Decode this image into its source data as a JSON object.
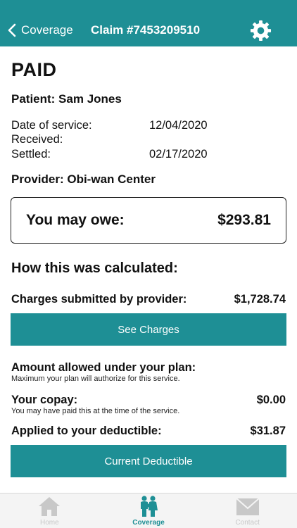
{
  "header": {
    "back_label": "Coverage",
    "title": "Claim #7453209510"
  },
  "claim": {
    "status": "PAID",
    "patient": "Patient: Sam Jones",
    "dates": [
      {
        "label": "Date of service:",
        "value": "12/04/2020"
      },
      {
        "label": "Received:",
        "value": ""
      },
      {
        "label": "Settled:",
        "value": "02/17/2020"
      }
    ],
    "provider": "Provider: Obi-wan Center"
  },
  "owe": {
    "label": "You may owe:",
    "value": "$293.81"
  },
  "calculation": {
    "title": "How this was calculated:",
    "charges_label": "Charges submitted by provider:",
    "charges_value": "$1,728.74",
    "see_charges_button": "See Charges",
    "allowed_label": "Amount allowed under your plan:",
    "allowed_sub": "Maximum your plan will authorize for this service.",
    "copay_label": "Your copay:",
    "copay_value": "$0.00",
    "copay_sub": "You may have paid this at the time of the service.",
    "deductible_label": "Applied to your deductible:",
    "deductible_value": "$31.87",
    "current_deductible_button": "Current Deductible"
  },
  "tabs": [
    {
      "label": "Home",
      "icon": "home-icon",
      "active": false
    },
    {
      "label": "Coverage",
      "icon": "family-icon",
      "active": true
    },
    {
      "label": "Contact",
      "icon": "envelope-icon",
      "active": false
    }
  ],
  "colors": {
    "primary": "#1e8f95",
    "tab_inactive": "#c8c8c8"
  }
}
